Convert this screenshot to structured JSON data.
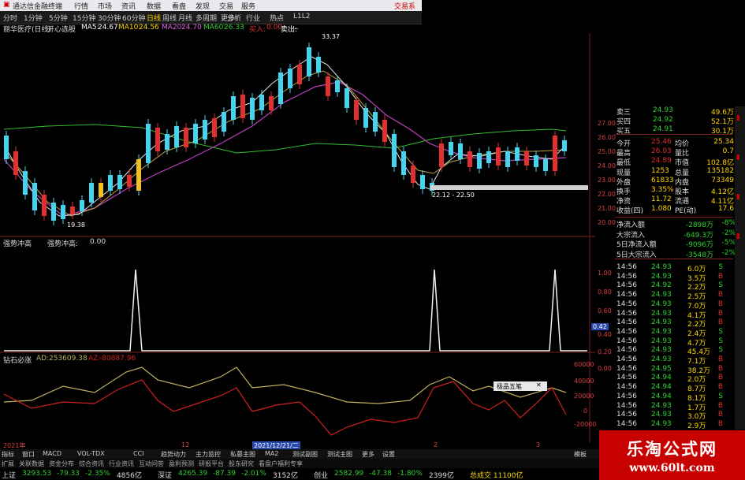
{
  "titlebar": {
    "app_title": "通达信金融终端",
    "menus": [
      "行情",
      "市场",
      "资讯",
      "数据",
      "看盘",
      "发现",
      "交易",
      "服务"
    ],
    "trade_link": "交易系"
  },
  "tabbar": {
    "tabs": [
      "分时",
      "1分钟",
      "5分钟",
      "15分钟",
      "30分钟",
      "60分钟",
      "日线",
      "周线",
      "月线",
      "多周期",
      "更多"
    ],
    "right_items": [
      "分析",
      "行业",
      "热点",
      "L1L2"
    ]
  },
  "ma_line": {
    "stock": "丽华医疗(日线)",
    "indicator": "开心选股",
    "ma5_label": "MA5:",
    "ma5": "24.67",
    "ma10_label": "MA10:",
    "ma10": "24.56",
    "ma20_label": "MA20:",
    "ma20": "24.70",
    "ma60_label": "MA60:",
    "ma60": "26.33",
    "buy_label": "买入:",
    "buy_value": "0.00",
    "sell_label": "卖出:",
    "sell_value": "..."
  },
  "price_axis": [
    "27.00",
    "26.00",
    "25.00",
    "24.00",
    "23.00",
    "22.00",
    "21.00",
    "20.00"
  ],
  "price_annotations": {
    "high": "33.37",
    "low": "19.38",
    "range": "22.12 - 22.50"
  },
  "indicator1": {
    "title": "强势冲高",
    "series": "强势冲高:",
    "value": "0.00",
    "axis": [
      "1.00",
      "0.80",
      "0.60",
      "0.42",
      "0.40",
      "0.20",
      "0.00"
    ]
  },
  "indicator2": {
    "title": "钻石必涨",
    "ad_label": "AD:",
    "ad_value": "253609.38",
    "az_label": "AZ:",
    "az_value": "-80887.96",
    "axis": [
      "60000",
      "40000",
      "20000",
      "0",
      "-20000"
    ]
  },
  "date_axis": {
    "left": "2021年",
    "mid1": "12",
    "highlight": "2021/12/21/二",
    "mid2": "2",
    "mid3": "3"
  },
  "popup": {
    "label": "极品五笔"
  },
  "quote": {
    "levels": [
      {
        "name": "卖三",
        "price": "24.93",
        "vol": "49.6万"
      },
      {
        "name": "买四",
        "price": "24.92",
        "vol": "52.1万"
      },
      {
        "name": "买五",
        "price": "24.91",
        "vol": "30.1万"
      }
    ],
    "stats": [
      {
        "l": "今开",
        "v": "25.46",
        "l2": "均价",
        "v2": "25.34"
      },
      {
        "l": "最高",
        "v": "26.03",
        "l2": "量比",
        "v2": "0.7"
      },
      {
        "l": "最低",
        "v": "24.89",
        "l2": "市值",
        "v2": "102.8亿"
      },
      {
        "l": "现量",
        "v": "1253",
        "l2": "总量",
        "v2": "135182"
      },
      {
        "l": "外盘",
        "v": "61833",
        "l2": "内盘",
        "v2": "73349"
      },
      {
        "l": "换手",
        "v": "3.35%",
        "l2": "股本",
        "v2": "4.12亿"
      },
      {
        "l": "净资",
        "v": "11.72",
        "l2": "流通",
        "v2": "4.11亿"
      },
      {
        "l": "收益(四)",
        "v": "1.080",
        "l2": "PE(动)",
        "v2": "17.6"
      }
    ],
    "flows": [
      {
        "l": "净流入额",
        "v": "-2898万",
        "p": "-8%"
      },
      {
        "l": "大宗流入",
        "v": "-649.3万",
        "p": "-2%"
      },
      {
        "l": "5日净流入额",
        "v": "-9096万",
        "p": "-5%"
      },
      {
        "l": "5日大宗流入",
        "v": "-3548万",
        "p": "-2%"
      }
    ],
    "ticks": [
      {
        "t": "14:56",
        "p": "24.93",
        "v": "6.0万",
        "d": "S"
      },
      {
        "t": "14:56",
        "p": "24.93",
        "v": "3.5万",
        "d": "B"
      },
      {
        "t": "14:56",
        "p": "24.92",
        "v": "2.2万",
        "d": "S"
      },
      {
        "t": "14:56",
        "p": "24.93",
        "v": "2.5万",
        "d": "B"
      },
      {
        "t": "14:56",
        "p": "24.93",
        "v": "7.0万",
        "d": "B"
      },
      {
        "t": "14:56",
        "p": "24.93",
        "v": "4.1万",
        "d": "B"
      },
      {
        "t": "14:56",
        "p": "24.93",
        "v": "2.2万",
        "d": "B"
      },
      {
        "t": "14:56",
        "p": "24.93",
        "v": "2.4万",
        "d": "S"
      },
      {
        "t": "14:56",
        "p": "24.93",
        "v": "4.7万",
        "d": "S"
      },
      {
        "t": "14:56",
        "p": "24.93",
        "v": "45.4万",
        "d": "S"
      },
      {
        "t": "14:56",
        "p": "24.93",
        "v": "7.1万",
        "d": "B"
      },
      {
        "t": "14:56",
        "p": "24.95",
        "v": "38.2万",
        "d": "B"
      },
      {
        "t": "14:56",
        "p": "24.94",
        "v": "2.0万",
        "d": "B"
      },
      {
        "t": "14:56",
        "p": "24.94",
        "v": "8.7万",
        "d": "B"
      },
      {
        "t": "14:56",
        "p": "24.94",
        "v": "8.1万",
        "d": "S"
      },
      {
        "t": "14:56",
        "p": "24.93",
        "v": "1.7万",
        "d": "B"
      },
      {
        "t": "14:56",
        "p": "24.93",
        "v": "3.0万",
        "d": "B"
      },
      {
        "t": "14:56",
        "p": "24.93",
        "v": "2.9万",
        "d": "B"
      }
    ]
  },
  "bottom_tabs": [
    "指标",
    "窗口",
    "MACD",
    "VOL-TDX",
    "CCI",
    "趋势动力",
    "主力监控",
    "私募主图",
    "MA2",
    "测试副图",
    "测试主图",
    "更多",
    "设置"
  ],
  "bottom_tabs2": [
    "扩展",
    "关联数据",
    "资金分布",
    "综合资讯",
    "行业资讯",
    "互动问答",
    "盈利预测",
    "研报平台",
    "股东研究",
    "看盘户福利专享"
  ],
  "bottom_right": "模板",
  "index_bar": [
    {
      "name": "上证",
      "v": "3293.53",
      "c": "-79.33",
      "p": "-2.35%",
      "amt": "4856亿"
    },
    {
      "name": "深证",
      "v": "4265.39",
      "c": "-87.39",
      "p": "-2.01%",
      "amt": "3152亿"
    },
    {
      "name": "创业",
      "v": "2582.99",
      "c": "-47.38",
      "p": "-1.80%",
      "amt": "2399亿"
    }
  ],
  "index_extra": "总成交 11100亿",
  "brand": {
    "title": "乐淘公式网",
    "url": "www.60lt.com"
  }
}
